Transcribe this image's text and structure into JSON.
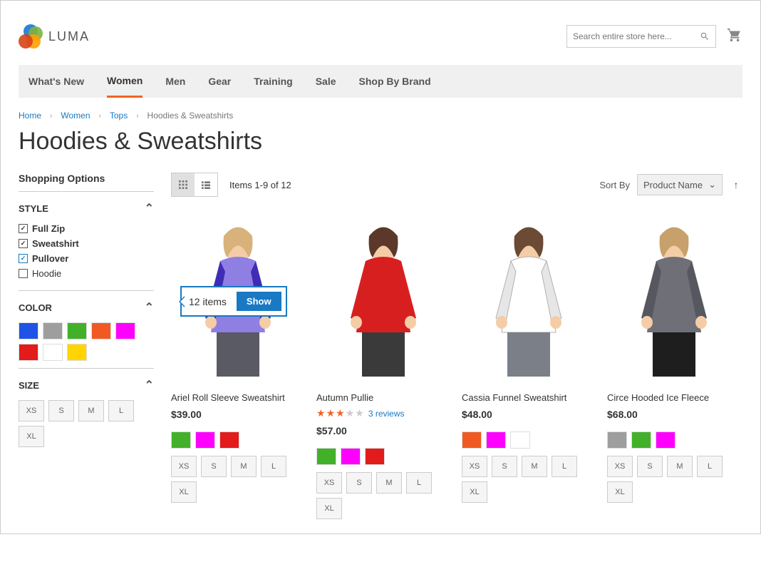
{
  "brand": "LUMA",
  "search_placeholder": "Search entire store here...",
  "nav": [
    "What's New",
    "Women",
    "Men",
    "Gear",
    "Training",
    "Sale",
    "Shop By Brand"
  ],
  "nav_active": 1,
  "breadcrumbs": [
    {
      "label": "Home",
      "link": true
    },
    {
      "label": "Women",
      "link": true
    },
    {
      "label": "Tops",
      "link": true
    },
    {
      "label": "Hoodies & Sweatshirts",
      "link": false
    }
  ],
  "page_title": "Hoodies & Sweatshirts",
  "sidebar": {
    "title": "Shopping Options",
    "style": {
      "label": "STYLE",
      "options": [
        {
          "label": "Full Zip",
          "checked": true,
          "selected": false
        },
        {
          "label": "Sweatshirt",
          "checked": true,
          "selected": false
        },
        {
          "label": "Pullover",
          "checked": true,
          "selected": true
        },
        {
          "label": "Hoodie",
          "checked": false,
          "selected": false
        }
      ]
    },
    "color": {
      "label": "COLOR",
      "swatches": [
        "#1e53e6",
        "#9e9e9e",
        "#43b02a",
        "#f05a22",
        "#ff00ff",
        "#e21b1b",
        "#ffffff",
        "#ffd400"
      ]
    },
    "size": {
      "label": "SIZE",
      "options": [
        "XS",
        "S",
        "M",
        "L",
        "XL"
      ]
    }
  },
  "callout": {
    "count": "12 items",
    "button": "Show"
  },
  "toolbar": {
    "count_text": "Items 1-9 of 12",
    "sort_label": "Sort By",
    "sort_value": "Product Name"
  },
  "products": [
    {
      "name": "Ariel Roll Sleeve Sweatshirt",
      "price": "$39.00",
      "colors": [
        "#43b02a",
        "#ff00ff",
        "#e21b1b"
      ],
      "sizes": [
        "XS",
        "S",
        "M",
        "L",
        "XL"
      ],
      "shirt": "#8f7fe3",
      "sleeve": "#3f2db5",
      "hair": "#d8b27a",
      "bottom": "#595a63"
    },
    {
      "name": "Autumn Pullie",
      "price": "$57.00",
      "rating": 3,
      "reviews": "3 reviews",
      "colors": [
        "#43b02a",
        "#ff00ff",
        "#e21b1b"
      ],
      "sizes": [
        "XS",
        "S",
        "M",
        "L",
        "XL"
      ],
      "shirt": "#d81f1f",
      "sleeve": "#d81f1f",
      "hair": "#5b382a",
      "bottom": "#3a3a3a"
    },
    {
      "name": "Cassia Funnel Sweatshirt",
      "price": "$48.00",
      "colors": [
        "#f05a22",
        "#ff00ff",
        "#ffffff"
      ],
      "sizes": [
        "XS",
        "S",
        "M",
        "L",
        "XL"
      ],
      "shirt": "#ffffff",
      "sleeve": "#e6e6e6",
      "hair": "#6b4b36",
      "bottom": "#7a7f88",
      "outline": true
    },
    {
      "name": "Circe Hooded Ice Fleece",
      "price": "$68.00",
      "colors": [
        "#9e9e9e",
        "#43b02a",
        "#ff00ff"
      ],
      "sizes": [
        "XS",
        "S",
        "M",
        "L",
        "XL"
      ],
      "shirt": "#6f6f78",
      "sleeve": "#57575f",
      "hair": "#c7a06b",
      "bottom": "#1e1e1e"
    }
  ]
}
